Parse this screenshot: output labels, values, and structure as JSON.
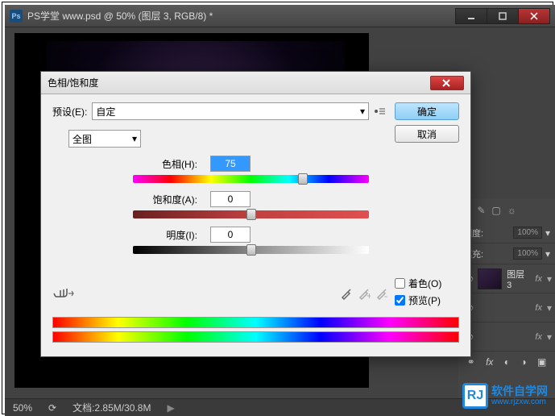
{
  "window": {
    "title": "PS学堂 www.psd @ 50% (图层 3, RGB/8) *",
    "ps_badge": "Ps"
  },
  "statusbar": {
    "zoom": "50%",
    "doc": "文档:2.85M/30.8M"
  },
  "panel": {
    "opacity_label": "明度:",
    "opacity_value": "100%",
    "fill_label": "填充:",
    "fill_value": "100%",
    "layer_name": "图层 3",
    "fx": "fx"
  },
  "dialog": {
    "title": "色相/饱和度",
    "ok": "确定",
    "cancel": "取消",
    "preset_label": "预设(E):",
    "preset_value": "自定",
    "edit_value": "全图",
    "hue_label": "色相(H):",
    "hue_value": "75",
    "sat_label": "饱和度(A):",
    "sat_value": "0",
    "lig_label": "明度(I):",
    "lig_value": "0",
    "colorize": "着色(O)",
    "preview": "预览(P)"
  },
  "watermark": {
    "badge": "RJ",
    "cn": "软件自学网",
    "url": "www.rjzxw.com"
  }
}
